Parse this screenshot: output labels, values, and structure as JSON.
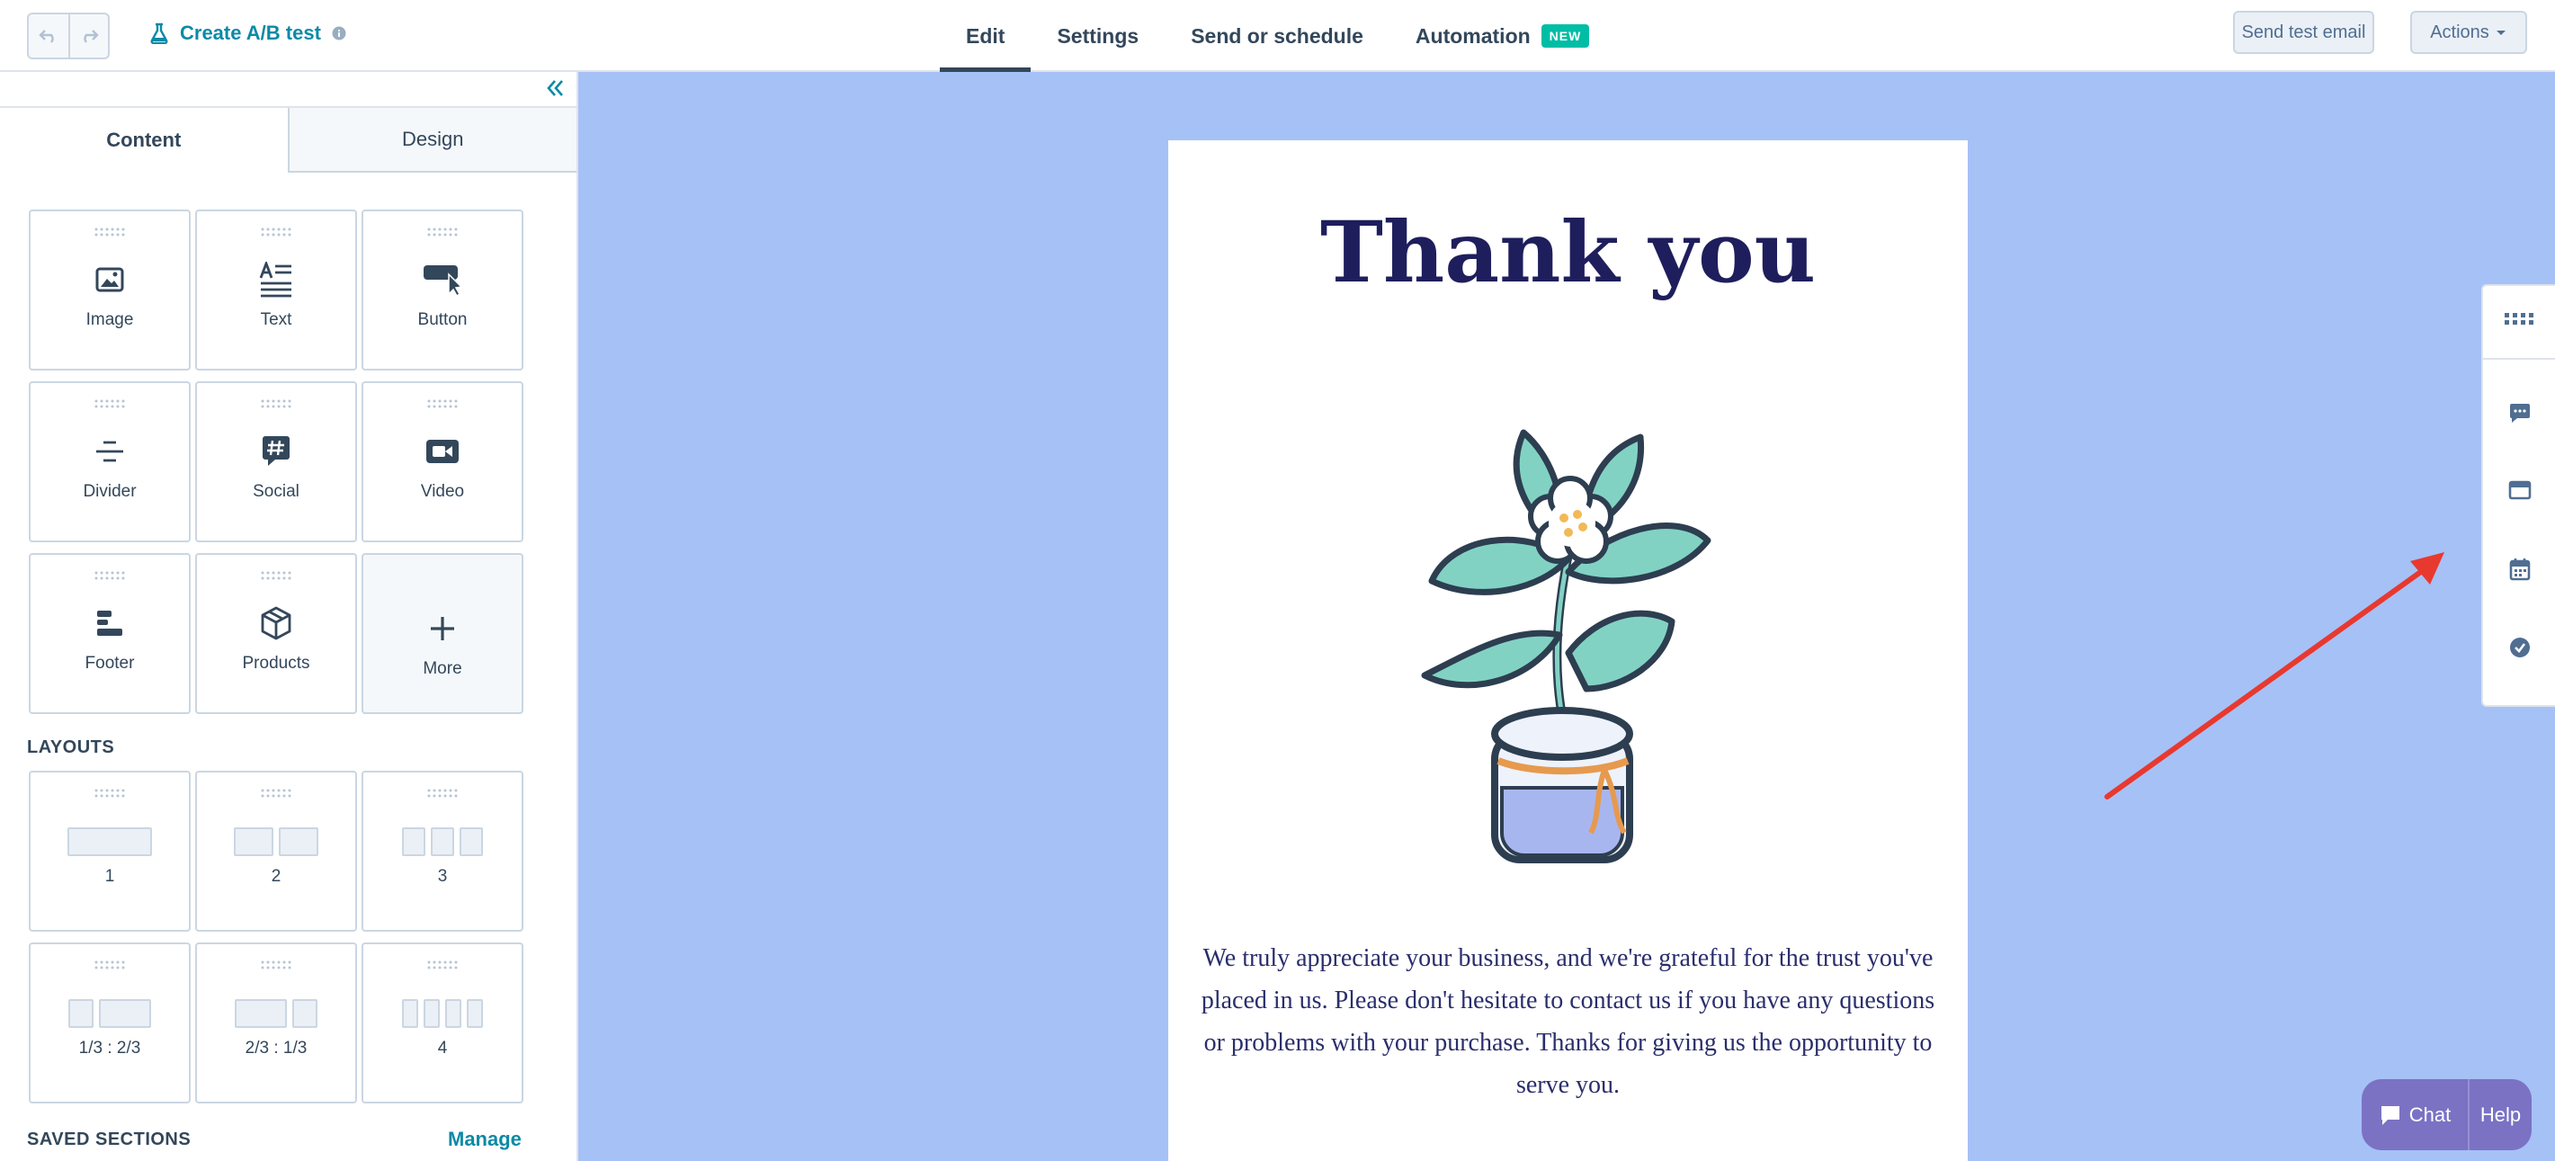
{
  "header": {
    "ab_test_label": "Create A/B test",
    "tabs": [
      {
        "label": "Edit"
      },
      {
        "label": "Settings"
      },
      {
        "label": "Send or schedule"
      },
      {
        "label": "Automation",
        "badge": "NEW"
      }
    ],
    "send_test_label": "Send test email",
    "actions_label": "Actions"
  },
  "sidebar": {
    "tabs": [
      {
        "label": "Content"
      },
      {
        "label": "Design"
      }
    ],
    "modules": [
      {
        "label": "Image",
        "icon": "image-icon"
      },
      {
        "label": "Text",
        "icon": "text-icon"
      },
      {
        "label": "Button",
        "icon": "button-icon"
      },
      {
        "label": "Divider",
        "icon": "divider-icon"
      },
      {
        "label": "Social",
        "icon": "social-icon"
      },
      {
        "label": "Video",
        "icon": "video-icon"
      },
      {
        "label": "Footer",
        "icon": "footer-icon"
      },
      {
        "label": "Products",
        "icon": "products-icon"
      },
      {
        "label": "More",
        "icon": "plus-icon"
      }
    ],
    "layouts_heading": "LAYOUTS",
    "layouts": [
      {
        "label": "1"
      },
      {
        "label": "2"
      },
      {
        "label": "3"
      },
      {
        "label": "1/3 : 2/3"
      },
      {
        "label": "2/3 : 1/3"
      },
      {
        "label": "4"
      }
    ],
    "saved_heading": "SAVED SECTIONS",
    "manage_label": "Manage"
  },
  "email": {
    "title": "Thank you",
    "body": "We truly appreciate your business, and we're grateful for the trust you've placed in us. Please don't hesitate to contact us if you have any questions or problems with your purchase. Thanks for giving us the opportunity to serve you."
  },
  "right_rail": {
    "icons": [
      "grid-icon",
      "comment-icon",
      "preview-icon",
      "calendar-icon",
      "check-circle-icon"
    ]
  },
  "chat_widget": {
    "chat_label": "Chat",
    "help_label": "Help"
  },
  "colors": {
    "canvas": "#a6c1f6",
    "link": "#0b8aa7",
    "title": "#1f1e5d",
    "annotation_arrow": "#e8392f"
  }
}
